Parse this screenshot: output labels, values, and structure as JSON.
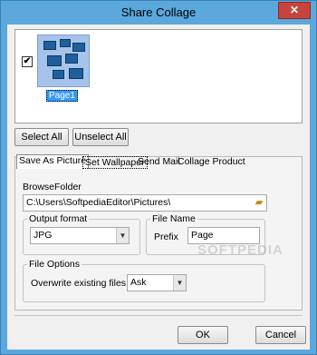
{
  "window": {
    "title": "Share Collage",
    "close_glyph": "✕"
  },
  "pages": [
    {
      "label": "Page1",
      "checked": true
    }
  ],
  "buttons": {
    "select_all": "Select All",
    "unselect_all": "Unselect All",
    "ok": "OK",
    "cancel": "Cancel"
  },
  "tabs": [
    "Save As Picture",
    "Set Wallpaper",
    "Send Mail",
    "Collage Product"
  ],
  "save_as_picture": {
    "browse_folder_label": "BrowseFolder",
    "folder_path": "C:\\Users\\SoftpediaEditor\\Pictures\\",
    "output_format": {
      "title": "Output format",
      "value": "JPG"
    },
    "file_name": {
      "title": "File Name",
      "prefix_label": "Prefix",
      "prefix_value": "Page"
    },
    "file_options": {
      "title": "File Options",
      "overwrite_label": "Overwrite existing files",
      "overwrite_value": "Ask"
    }
  },
  "icons": {
    "folder": "folder-icon",
    "dropdown": "chevron-down-icon",
    "close": "close-icon",
    "check": "checkbox-check-icon"
  },
  "watermark": "SOFTPEDIA"
}
